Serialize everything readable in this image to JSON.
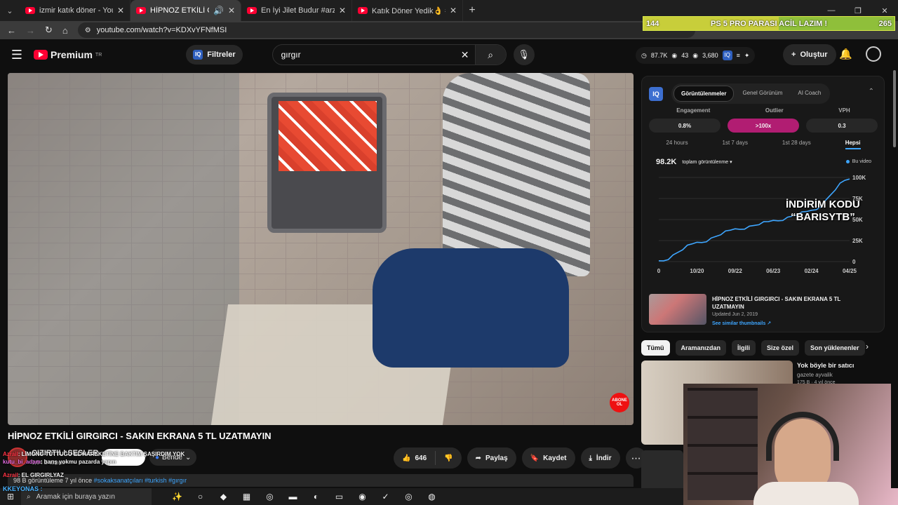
{
  "browser": {
    "tabs": [
      {
        "title": "izmir katık döner - YouTube",
        "active": false
      },
      {
        "title": "HİPNOZ ETKİLİ GIRGIRCI - S",
        "active": true
      },
      {
        "title": "En İyi Jilet Budur #arzufilm #ne",
        "active": false
      },
      {
        "title": "Katık Döner Yedik👌 #katık #dö",
        "active": false
      }
    ],
    "url": "youtube.com/watch?v=KDXvYFNfMSI"
  },
  "overlay_donation": {
    "left": "144",
    "text": "PS 5 PRO PARASI ACİL LAZIM !",
    "right": "265",
    "progress": 0.54
  },
  "masthead": {
    "logo": "Premium",
    "logo_sup": "TR",
    "filter_label": "Filtreler",
    "search_value": "gırgır",
    "stats": {
      "views": "87.7K",
      "likes": "43",
      "watching": "3,680"
    },
    "create_label": "Oluştur"
  },
  "video": {
    "title": "HİPNOZ ETKİLİ GIRGIRCI - SAKIN EKRANA 5 TL UZATMAYIN",
    "badge": "ABONE OL"
  },
  "channel": {
    "name": "CIZIRTILI SESLER",
    "subs": "1,64 B abone",
    "subscribe_label": "Bende"
  },
  "actions": {
    "likes": "646",
    "share": "Paylaş",
    "save": "Kaydet",
    "download": "İndir"
  },
  "description": {
    "views": "98 B görüntüleme  7 yıl önce",
    "tags": "#sokaksanatçıları #turkish #gırgır"
  },
  "chat": [
    {
      "user": "Azrail",
      "msg": ": LİMONU TUTTUĞU EL HAREKETİNE BAKTIM ŞAŞIRDIM YOK"
    },
    {
      "user": "kutu_bi_adam",
      "msg": ": barış yokmu pazarda yapın"
    },
    {
      "user": "Azrail",
      "msg": ": EL GIRGIRLYAZ"
    }
  ],
  "chat_footer": "KKEYONAS :",
  "iq_panel": {
    "logo": "IQ",
    "tabs": [
      "Görüntülenmeler",
      "Genel Görünüm",
      "AI Coach"
    ],
    "metrics": [
      {
        "label": "Engagement",
        "value": "0.8%"
      },
      {
        "label": "Outlier",
        "value": ">100x"
      },
      {
        "label": "VPH",
        "value": "0.3"
      }
    ],
    "periods": [
      "24 hours",
      "1st 7 days",
      "1st 28 days",
      "Hepsi"
    ],
    "total": "98.2K",
    "total_label": "toplam görüntülenme ▾",
    "legend": "Bu video",
    "promo_line1": "İNDİRİM KODU",
    "promo_line2": "“BARISYTB”",
    "ref_title": "HİPNOZ ETKİLİ GIRGIRCI - SAKIN EKRANA 5 TL UZATMAYIN",
    "ref_date": "Updated Jun 2, 2019",
    "ref_link": "See similar thumbnails ↗"
  },
  "chart_data": {
    "type": "line",
    "x": [
      "0",
      "10/20",
      "09/22",
      "06/23",
      "02/24",
      "04/25"
    ],
    "series": [
      {
        "name": "Bu video",
        "values": [
          0,
          22000,
          38000,
          48000,
          60000,
          98200
        ]
      }
    ],
    "y_ticks": [
      "100K",
      "75K",
      "50K",
      "25K",
      "0"
    ],
    "ylim": [
      0,
      100000
    ]
  },
  "chips": [
    "Tümü",
    "Aramanızdan",
    "İlgili",
    "Size özel",
    "Son yüklenenler"
  ],
  "recommended": {
    "title": "Yok böyle bir satıcı",
    "channel": "gazete ayvalik",
    "meta": "175 B · 4 yıl önce"
  },
  "taskbar": {
    "search_placeholder": "Aramak için buraya yazın"
  }
}
